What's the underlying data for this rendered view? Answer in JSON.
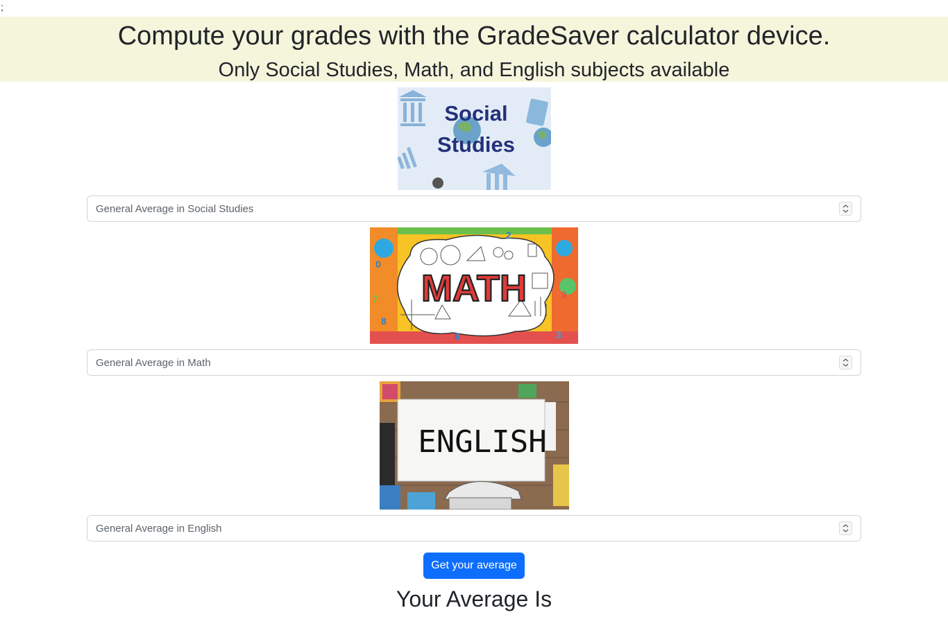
{
  "stray_text": ";",
  "header": {
    "title": "Compute your grades with the GradeSaver calculator device.",
    "subtitle": "Only Social Studies, Math, and English subjects available"
  },
  "subjects": [
    {
      "image_text": [
        "Social",
        "Studies"
      ],
      "placeholder": "General Average in Social Studies"
    },
    {
      "image_text": "MATH",
      "placeholder": "General Average in Math"
    },
    {
      "image_text": "ENGLISH",
      "placeholder": "General Average in English"
    }
  ],
  "button": {
    "label": "Get your average"
  },
  "result": {
    "label": "Your Average Is"
  },
  "colors": {
    "banner": "#f5f5dc",
    "button": "#0d6efd",
    "social_title": "#24307a"
  }
}
